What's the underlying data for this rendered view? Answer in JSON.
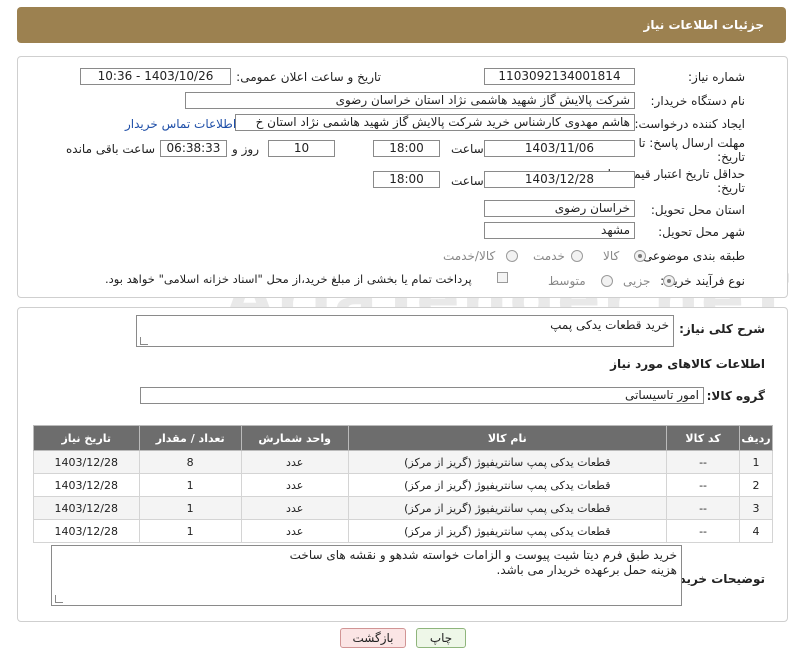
{
  "header": {
    "title": "جزئیات اطلاعات نیاز"
  },
  "form": {
    "need_number": {
      "label": "شماره نیاز:",
      "value": "1103092134001814"
    },
    "announce_datetime": {
      "label": "تاریخ و ساعت اعلان عمومی:",
      "value": "1403/10/26 - 10:36"
    },
    "buyer_org": {
      "label": "نام دستگاه خریدار:",
      "value": "شرکت پالایش گاز شهید هاشمی نژاد   استان خراسان رضوی"
    },
    "requester": {
      "label": "ایجاد کننده درخواست:",
      "value": "هاشم مهدوی کارشناس خرید شرکت پالایش گاز شهید هاشمی نژاد   استان خ",
      "contact_link": "اطلاعات تماس خریدار"
    },
    "reply_deadline": {
      "label": "مهلت ارسال پاسخ: تا تاریخ:",
      "date": "1403/11/06",
      "time_label": "ساعت",
      "time": "18:00",
      "days": "10",
      "days_label": "روز و",
      "remaining": "06:38:33",
      "remaining_label": "ساعت باقی مانده"
    },
    "price_validity": {
      "label": "حداقل تاریخ اعتبار قیمت: تا تاریخ:",
      "date": "1403/12/28",
      "time_label": "ساعت",
      "time": "18:00"
    },
    "province": {
      "label": "استان محل تحویل:",
      "value": "خراسان رضوی"
    },
    "city": {
      "label": "شهر محل تحویل:",
      "value": "مشهد"
    },
    "category": {
      "label": "طبقه بندی موضوعی:",
      "options": [
        "کالا",
        "خدمت",
        "کالا/خدمت"
      ],
      "selected": "کالا"
    },
    "purchase_type": {
      "label": "نوع فرآیند خرید :",
      "options": [
        "جزیی",
        "متوسط"
      ],
      "selected": "جزیی",
      "note": "پرداخت تمام یا بخشی از مبلغ خرید،از محل \"اسناد خزانه اسلامی\" خواهد بود."
    }
  },
  "summary": {
    "label": "شرح کلی نیاز:",
    "value": "خرید قطعات یدکی پمپ"
  },
  "goods_section": {
    "title": "اطلاعات کالاهای مورد نیاز",
    "group_label": "گروه کالا:",
    "group_value": "امور تاسیساتی"
  },
  "table": {
    "headers": [
      "ردیف",
      "کد کالا",
      "نام کالا",
      "واحد شمارش",
      "تعداد / مقدار",
      "تاریخ نیاز"
    ],
    "rows": [
      [
        "1",
        "--",
        "قطعات یدکی پمپ سانتریفیوژ (گریز از مرکز)",
        "عدد",
        "8",
        "1403/12/28"
      ],
      [
        "2",
        "--",
        "قطعات یدکی پمپ سانتریفیوژ (گریز از مرکز)",
        "عدد",
        "1",
        "1403/12/28"
      ],
      [
        "3",
        "--",
        "قطعات یدکی پمپ سانتریفیوژ (گریز از مرکز)",
        "عدد",
        "1",
        "1403/12/28"
      ],
      [
        "4",
        "--",
        "قطعات یدکی پمپ سانتریفیوژ (گریز از مرکز)",
        "عدد",
        "1",
        "1403/12/28"
      ]
    ]
  },
  "buyer_notes": {
    "label": "توضیحات خریدار:",
    "line1": "خرید طبق فرم دیتا شیت پیوست و الزامات خواسته شدهو و نقشه های ساخت",
    "line2": "هزینه حمل برعهده خریدار می باشد."
  },
  "buttons": {
    "print": "چاپ",
    "back": "بازگشت"
  },
  "watermark": "AriaTender.neT"
}
